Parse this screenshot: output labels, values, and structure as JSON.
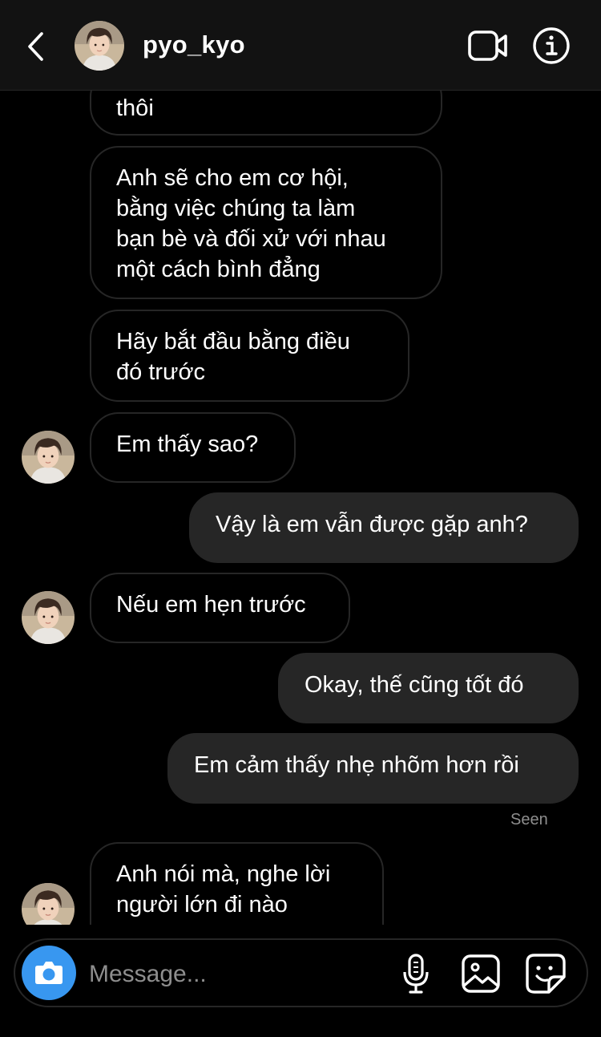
{
  "header": {
    "username": "pyo_kyo",
    "icons": {
      "back": "chevron-left-icon",
      "video": "video-camera-icon",
      "info": "info-icon"
    }
  },
  "thread": {
    "messages": [
      {
        "sender": "other",
        "text": "thôi"
      },
      {
        "sender": "other",
        "text": "Anh sẽ cho em cơ hội,\nbằng việc chúng ta làm\nbạn bè và đối xử với nhau\nmột cách bình đẳng"
      },
      {
        "sender": "other",
        "text": "Hãy bắt đầu bằng điều\nđó trước"
      },
      {
        "sender": "other",
        "text": "Em thấy sao?"
      },
      {
        "sender": "me",
        "text": "Vậy là em vẫn được gặp anh?"
      },
      {
        "sender": "other",
        "text": "Nếu em hẹn trước"
      },
      {
        "sender": "me",
        "text": "Okay, thế cũng tốt đó"
      },
      {
        "sender": "me",
        "text": "Em cảm thấy nhẹ nhõm hơn rồi"
      },
      {
        "sender": "other",
        "text": "Anh nói mà, nghe lời\nngười lớn đi nào"
      }
    ],
    "seen_label": "Seen"
  },
  "composer": {
    "placeholder": "Message...",
    "icons": {
      "camera": "camera-icon",
      "mic": "microphone-icon",
      "gallery": "image-icon",
      "sticker": "sticker-icon"
    }
  },
  "colors": {
    "background": "#000000",
    "header": "#121212",
    "my_bubble": "#262626",
    "accent": "#3897f0",
    "muted": "#8e8e8e"
  }
}
